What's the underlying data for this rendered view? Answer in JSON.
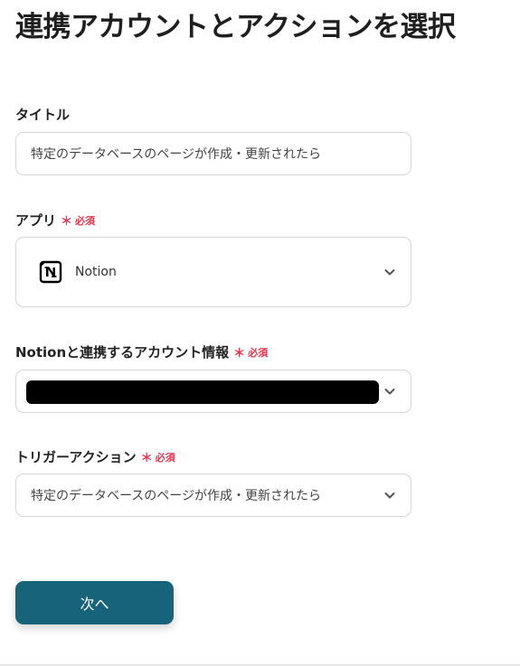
{
  "page": {
    "title": "連携アカウントとアクションを選択"
  },
  "title_field": {
    "label": "タイトル",
    "value": "特定のデータベースのページが作成・更新されたら"
  },
  "app_field": {
    "label": "アプリ",
    "required": "必須",
    "selected_app": "Notion",
    "icon": "notion-icon"
  },
  "account_field": {
    "label": "Notionと連携するアカウント情報",
    "required": "必須"
  },
  "trigger_field": {
    "label": "トリガーアクション",
    "required": "必須",
    "selected": "特定のデータベースのページが作成・更新されたら"
  },
  "buttons": {
    "next": "次へ"
  },
  "colors": {
    "primary": "#16637a",
    "required": "#e8344e",
    "border": "#d6d6d6"
  }
}
